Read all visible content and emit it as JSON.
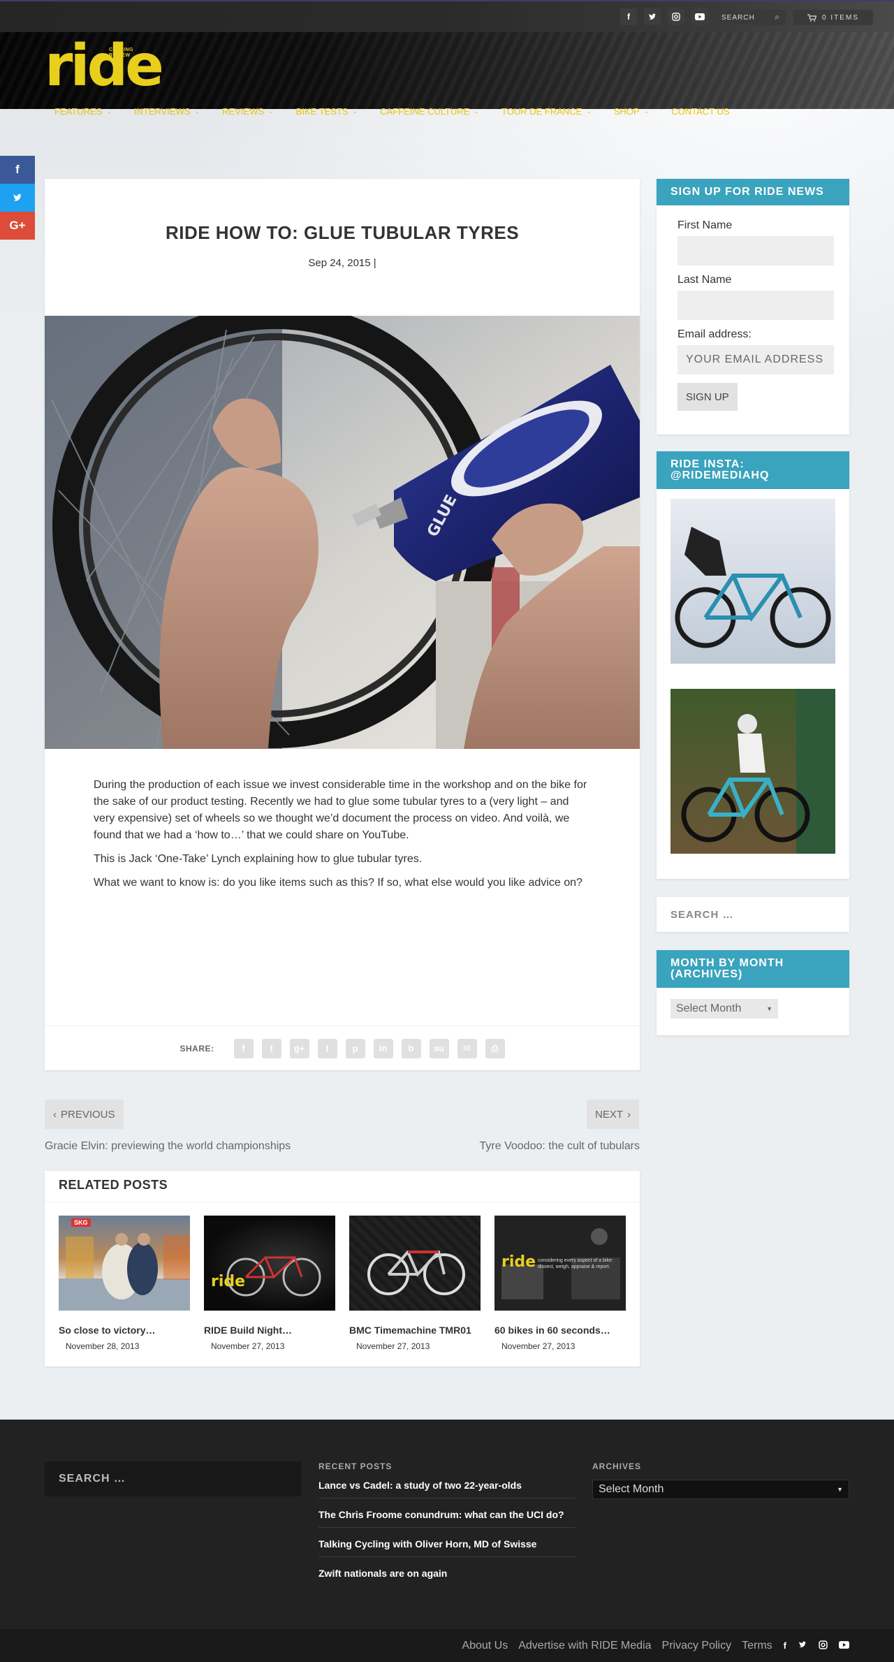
{
  "topbar": {
    "social_icons": [
      "facebook-icon",
      "twitter-icon",
      "instagram-icon",
      "youtube-icon"
    ],
    "search_placeholder": "SEARCH",
    "cart_label": "0 ITEMS"
  },
  "header": {
    "logo_text": "ride",
    "logo_sub": "CYCLING REVIEW",
    "nav": [
      {
        "label": "FEATURES"
      },
      {
        "label": "INTERVIEWS"
      },
      {
        "label": "REVIEWS"
      },
      {
        "label": "BIKE TESTS"
      },
      {
        "label": "CAFFEINE CULTURE"
      },
      {
        "label": "TOUR DE FRANCE"
      },
      {
        "label": "SHOP"
      },
      {
        "label": "CONTACT US"
      }
    ]
  },
  "side_share": [
    {
      "icon": "facebook-icon",
      "glyph": "f",
      "color": "#3b5998"
    },
    {
      "icon": "twitter-icon",
      "glyph": "t",
      "color": "#1da1f2"
    },
    {
      "icon": "google-plus-icon",
      "glyph": "G+",
      "color": "#dd4b39"
    }
  ],
  "post": {
    "title": "RIDE HOW TO: GLUE TUBULAR TYRES",
    "meta": "Sep 24, 2015 |",
    "paragraphs": [
      "During the production of each issue we invest considerable time in the workshop and on the bike for the sake of our product testing. Recently we had to glue some tubular tyres to a (very light – and very expensive) set of wheels so we thought we’d document the process on video. And voilà, we found that we had a ‘how to…’ that we could share on YouTube.",
      "This is Jack ‘One-Take’ Lynch explaining how to glue tubular tyres.",
      "What we want to know is: do you like items such as this? If so, what else would you like advice on?"
    ],
    "hero_tube_label": "GLUE",
    "share_label": "SHARE:",
    "share_icons": [
      "f",
      "t",
      "g+",
      "t",
      "p",
      "in",
      "b",
      "su",
      "✉",
      "⎙"
    ]
  },
  "pagination": {
    "prev_label": "PREVIOUS",
    "prev_title": "Gracie Elvin: previewing the world championships",
    "next_label": "NEXT",
    "next_title": "Tyre Voodoo: the cult of tubulars"
  },
  "related": {
    "heading": "RELATED POSTS",
    "items": [
      {
        "title": "So close to victory…",
        "date": "November 28, 2013",
        "thumb_text": "SKG"
      },
      {
        "title": "RIDE Build Night…",
        "date": "November 27, 2013",
        "thumb_text": "ride"
      },
      {
        "title": "BMC Timemachine TMR01",
        "date": "November 27, 2013",
        "thumb_text": ""
      },
      {
        "title": "60 bikes in 60 seconds…",
        "date": "November 27, 2013",
        "thumb_text": "ride"
      }
    ],
    "thumb4_caption": "considering every aspect of a bike: dissect, weigh, appraise & report."
  },
  "sidebar": {
    "signup": {
      "heading": "SIGN UP FOR RIDE NEWS",
      "first_name_label": "First Name",
      "last_name_label": "Last Name",
      "email_label": "Email address:",
      "email_placeholder": "YOUR EMAIL ADDRESS",
      "button": "SIGN UP"
    },
    "insta": {
      "heading": "RIDE INSTA: @RIDEMEDIAHQ"
    },
    "search_placeholder": "SEARCH …",
    "archives": {
      "heading": "MONTH BY MONTH (ARCHIVES)",
      "select_value": "Select Month"
    }
  },
  "footer": {
    "search_placeholder": "SEARCH …",
    "recent_heading": "RECENT POSTS",
    "recent_posts": [
      "Lance vs Cadel: a study of two 22-year-olds",
      "The Chris Froome conundrum: what can the UCI do?",
      "Talking Cycling with Oliver Horn, MD of Swisse",
      "Zwift nationals are on again"
    ],
    "archives_heading": "ARCHIVES",
    "archives_value": "Select Month",
    "bottom_links": [
      "About Us",
      "Advertise with RIDE Media",
      "Privacy Policy",
      "Terms"
    ],
    "bottom_icons": [
      "facebook-icon",
      "twitter-icon",
      "instagram-icon",
      "youtube-icon"
    ]
  },
  "colors": {
    "accent_teal": "#3aa3bd",
    "nav_yellow": "#e8c312",
    "logo_yellow": "#e8cf1c",
    "footer_bg": "#222222"
  }
}
